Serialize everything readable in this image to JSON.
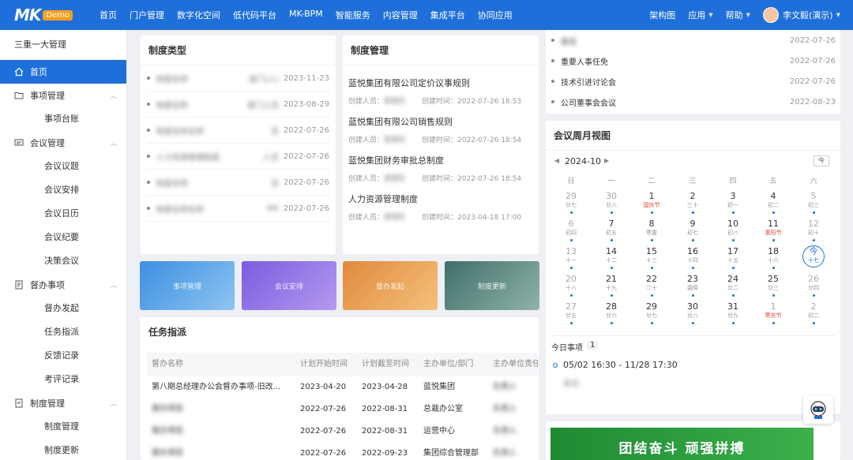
{
  "brand": {
    "logo_text": "MK",
    "badge": "Demo"
  },
  "nav": [
    "首页",
    "门户管理",
    "数字化空间",
    "低代码平台",
    "MK-BPM",
    "智能服务",
    "内容管理",
    "集成平台",
    "协同应用"
  ],
  "topright": {
    "arch": "架构图",
    "apps": "应用",
    "help": "帮助",
    "user": "李文毅(演示)"
  },
  "sidebar": {
    "title": "三重一大管理",
    "home": "首页",
    "groups": [
      {
        "label": "事项管理",
        "icon": "folder-icon",
        "children": [
          "事项台账"
        ]
      },
      {
        "label": "会议管理",
        "icon": "meeting-icon",
        "children": [
          "会议议题",
          "会议安排",
          "会议日历",
          "会议纪要",
          "决策会议"
        ]
      },
      {
        "label": "督办事项",
        "icon": "supervise-icon",
        "children": [
          "督办发起",
          "任务指派",
          "反馈记录",
          "考评记录"
        ]
      },
      {
        "label": "制度管理",
        "icon": "policy-icon",
        "children": [
          "制度管理",
          "制度更新"
        ]
      }
    ]
  },
  "policy_types": {
    "title": "制度类型",
    "rows": [
      {
        "name": "制度名称",
        "owner": "部门(人)",
        "date": "2023-11-23"
      },
      {
        "name": "制度名称",
        "owner": "部门人员",
        "date": "2023-08-29"
      },
      {
        "name": "制度名称名称",
        "owner": "员",
        "date": "2022-07-26"
      },
      {
        "name": "人力资源管理制度",
        "owner": "人员",
        "date": "2022-07-26"
      },
      {
        "name": "制度名称",
        "owner": "员",
        "date": "2022-07-26"
      },
      {
        "name": "制度名称名称",
        "owner": "MK",
        "date": "2022-07-26"
      }
    ]
  },
  "policy_mgmt": {
    "title": "制度管理",
    "creator_label": "创建人员：",
    "time_label": "创建时间：",
    "items": [
      {
        "name": "蓝悦集团有限公司定价议事规则",
        "creator": "管理员",
        "time": "2022-07-26 18:53"
      },
      {
        "name": "蓝悦集团有限公司销售规则",
        "creator": "管理员",
        "time": "2022-07-26 18:54"
      },
      {
        "name": "蓝悦集团财务审批总制度",
        "creator": "管理员",
        "time": "2022-07-26 18:54"
      },
      {
        "name": "人力资源管理制度",
        "creator": "管理员",
        "time": "2023-04-18 17:00"
      }
    ]
  },
  "meetings_list": [
    {
      "name": "会议",
      "date": "2022-07-26"
    },
    {
      "name": "重要人事任免",
      "date": "2022-07-26"
    },
    {
      "name": "技术引进讨论会",
      "date": "2022-07-26"
    },
    {
      "name": "公司董事会会议",
      "date": "2022-08-23"
    }
  ],
  "banners": [
    {
      "label": "事项管理",
      "color1": "#3d8fe0",
      "color2": "#8ec4f2"
    },
    {
      "label": "会议安排",
      "color1": "#7a5ce0",
      "color2": "#b49af0"
    },
    {
      "label": "督办发起",
      "color1": "#e08a3d",
      "color2": "#f5c07a"
    },
    {
      "label": "制度更新",
      "color1": "#3f6f6a",
      "color2": "#8fb3a8"
    }
  ],
  "tasks": {
    "title": "任务指派",
    "headers": [
      "督办名称",
      "计划开始时间",
      "计划截至时间",
      "主办单位/部门",
      "主办单位责任人"
    ],
    "rows": [
      [
        "第八期总经理办公会督办事项-旧改...",
        "2023-04-20",
        "2023-04-28",
        "蓝悦集团",
        "负责人"
      ],
      [
        "督办项目",
        "2022-07-26",
        "2022-08-31",
        "总裁办公室",
        "负责人"
      ],
      [
        "督办项目",
        "2022-07-26",
        "2022-08-31",
        "运营中心",
        "负责人"
      ],
      [
        "督办项目",
        "2022-07-26",
        "2022-09-23",
        "集团综合管理部",
        "负责人"
      ]
    ]
  },
  "calendar": {
    "title": "会议周月视图",
    "month": "2024-10",
    "today_btn": "今",
    "weekdays": [
      "日",
      "一",
      "二",
      "三",
      "四",
      "五",
      "六"
    ],
    "weeks": [
      [
        {
          "d": "29",
          "l": "廿七",
          "dim": true,
          "p": true
        },
        {
          "d": "30",
          "l": "廿八",
          "dim": true,
          "p": true
        },
        {
          "d": "1",
          "l": "国庆节",
          "red": true,
          "p": true
        },
        {
          "d": "2",
          "l": "三十",
          "p": true
        },
        {
          "d": "3",
          "l": "初一",
          "p": true
        },
        {
          "d": "4",
          "l": "初二",
          "p": true
        },
        {
          "d": "5",
          "l": "初三",
          "dim": true,
          "p": true
        }
      ],
      [
        {
          "d": "6",
          "l": "初四",
          "dim": true,
          "p": true
        },
        {
          "d": "7",
          "l": "初五",
          "p": true
        },
        {
          "d": "8",
          "l": "寒露",
          "p": true
        },
        {
          "d": "9",
          "l": "初七",
          "p": true
        },
        {
          "d": "10",
          "l": "初八",
          "p": true
        },
        {
          "d": "11",
          "l": "重阳节",
          "red": true,
          "p": true
        },
        {
          "d": "12",
          "l": "初十",
          "dim": true,
          "p": true
        }
      ],
      [
        {
          "d": "13",
          "l": "十一",
          "dim": true,
          "p": true
        },
        {
          "d": "14",
          "l": "十二",
          "p": true
        },
        {
          "d": "15",
          "l": "十三",
          "p": true
        },
        {
          "d": "16",
          "l": "十四",
          "p": true
        },
        {
          "d": "17",
          "l": "十五",
          "p": true
        },
        {
          "d": "18",
          "l": "十六",
          "p": true
        },
        {
          "d": "今",
          "l": "十七",
          "today": true
        }
      ],
      [
        {
          "d": "20",
          "l": "十八",
          "dim": true,
          "p": true
        },
        {
          "d": "21",
          "l": "十九",
          "p": true
        },
        {
          "d": "22",
          "l": "二十",
          "p": true
        },
        {
          "d": "23",
          "l": "霜降",
          "p": true
        },
        {
          "d": "24",
          "l": "廿二",
          "p": true
        },
        {
          "d": "25",
          "l": "廿三",
          "p": true
        },
        {
          "d": "26",
          "l": "廿四",
          "dim": true,
          "p": true
        }
      ],
      [
        {
          "d": "27",
          "l": "廿五",
          "dim": true,
          "p": true
        },
        {
          "d": "28",
          "l": "廿六",
          "p": true
        },
        {
          "d": "29",
          "l": "廿七",
          "p": true
        },
        {
          "d": "30",
          "l": "廿八",
          "p": true
        },
        {
          "d": "31",
          "l": "廿九",
          "p": true
        },
        {
          "d": "1",
          "l": "寒衣节",
          "red": true,
          "dim": true,
          "p": true
        },
        {
          "d": "2",
          "l": "初二",
          "dim": true,
          "p": true
        }
      ]
    ],
    "today_events_label": "今日事项",
    "today_events_count": "1",
    "event_time": "05/02 16:30 - 11/28 17:30",
    "event_name": "会议"
  },
  "slogan": "团结奋斗 顽强拼搏",
  "colors": {
    "primary": "#1e6fd9",
    "badge": "#ff9e1b",
    "slogan_bg": "#2e9c3a"
  }
}
